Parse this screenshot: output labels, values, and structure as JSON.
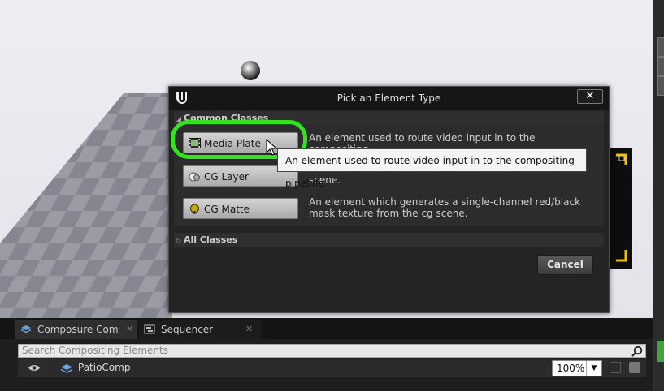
{
  "dialog": {
    "title": "Pick an Element Type",
    "close_label": "✕",
    "common_section": "Common Classes",
    "all_section": "All Classes",
    "elements": [
      {
        "label": "Media Plate",
        "icon": "film-icon",
        "description": "An element used to route video input in to the compositing"
      },
      {
        "label": "CG Layer",
        "icon": "cg-layer-icon",
        "description": "scene."
      },
      {
        "label": "CG Matte",
        "icon": "cg-matte-icon",
        "description": "An element which generates a single-channel red/black mask texture from the cg scene."
      }
    ],
    "cancel_label": "Cancel"
  },
  "tooltip": {
    "text": "An element used to route video input in to the compositing pipeline."
  },
  "panel": {
    "tabs": [
      {
        "label": "Composure Compo",
        "icon": "layers-icon",
        "active": true
      },
      {
        "label": "Sequencer",
        "icon": "sequencer-icon",
        "active": false
      }
    ],
    "search_placeholder": "Search Compositing Elements",
    "row": {
      "label": "PatioComp",
      "visibility_icon": "eye-icon",
      "type_icon": "layers-icon"
    },
    "zoom": "100%"
  },
  "colors": {
    "highlight": "#33e31e",
    "accent_yellow": "#f0c000"
  }
}
